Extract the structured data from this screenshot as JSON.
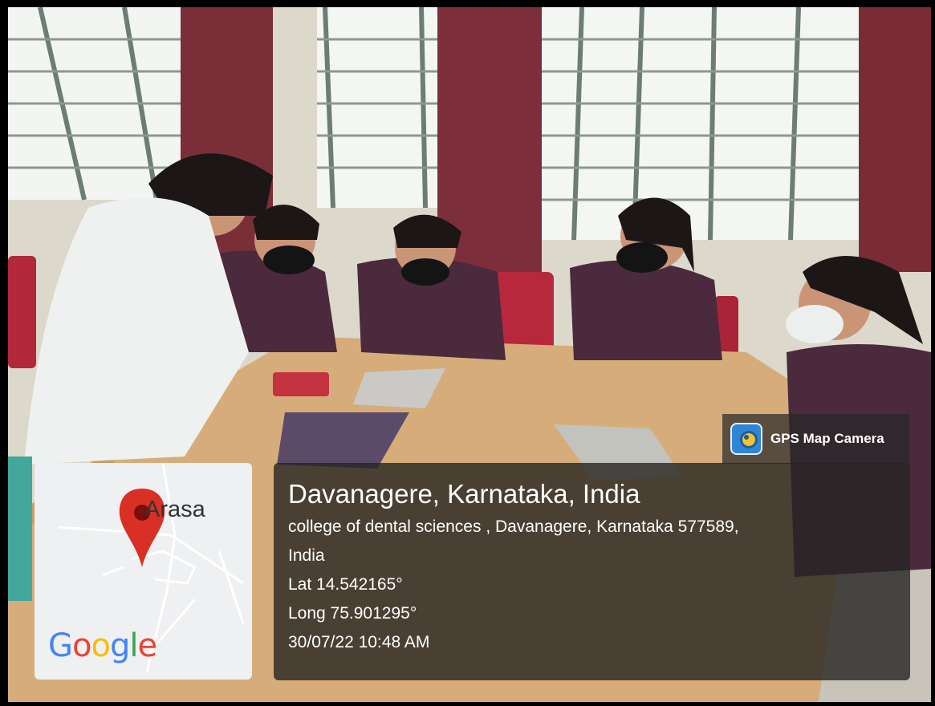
{
  "app": {
    "name": "GPS Map Camera",
    "icon": "gps-map-camera-icon"
  },
  "map": {
    "place_label": "Arasa",
    "provider": "Google",
    "marker_icon": "map-pin-icon",
    "marker_color": "#d93025"
  },
  "location": {
    "title": "Davanagere, Karnataka, India",
    "address_line1": "college of dental sciences , Davanagere, Karnataka 577589,",
    "address_line2": "India",
    "lat": "Lat 14.542165°",
    "long": "Long 75.901295°",
    "datetime": "30/07/22 10:48 AM"
  },
  "colors": {
    "overlay": "#262422",
    "scrub": "#4a2a3c",
    "curtain": "#7a2f38",
    "table": "#d6ad7a"
  }
}
